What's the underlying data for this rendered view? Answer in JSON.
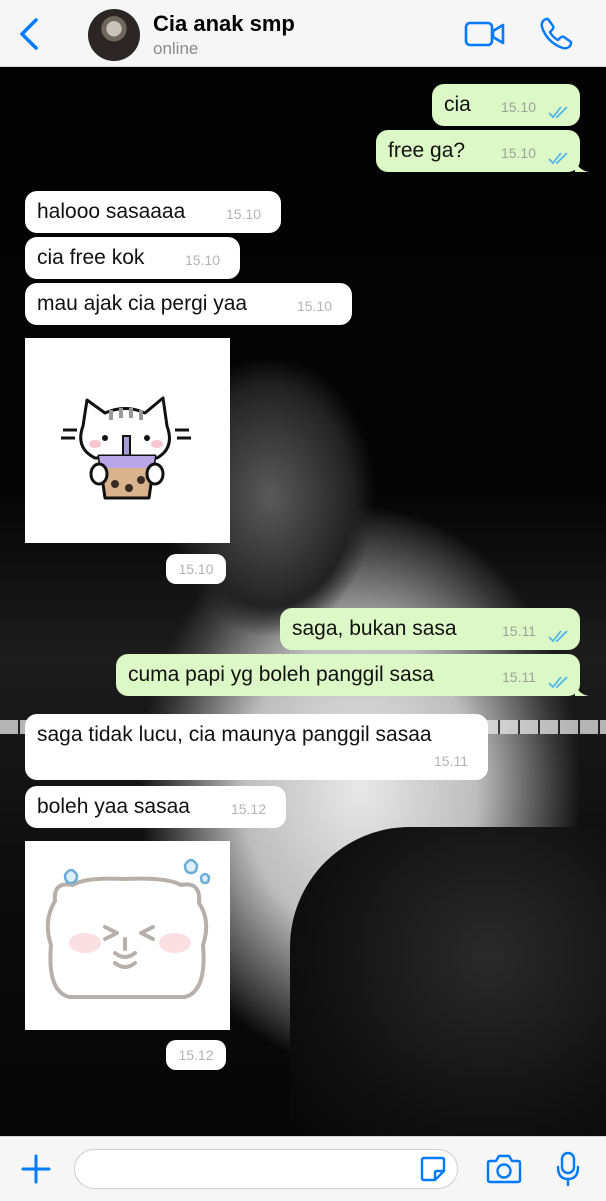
{
  "header": {
    "title": "Cia anak smp",
    "status": "online"
  },
  "messages": [
    {
      "kind": "out",
      "text": "cia",
      "time": "15.10"
    },
    {
      "kind": "out",
      "text": "free ga?",
      "time": "15.10"
    },
    {
      "kind": "in",
      "text": "halooo sasaaaa",
      "time": "15.10"
    },
    {
      "kind": "in",
      "text": "cia free kok",
      "time": "15.10"
    },
    {
      "kind": "in",
      "text": "mau ajak cia pergi yaa",
      "time": "15.10"
    },
    {
      "kind": "sticker",
      "sticker": "cat-drinking-boba-sticker",
      "time": "15.10"
    },
    {
      "kind": "out",
      "text": "saga, bukan sasa",
      "time": "15.11"
    },
    {
      "kind": "out",
      "text": "cuma papi yg boleh panggil sasa",
      "time": "15.11"
    },
    {
      "kind": "in",
      "text": "saga tidak lucu, cia maunya panggil sasaa",
      "time": "15.11"
    },
    {
      "kind": "in",
      "text": "boleh yaa sasaa",
      "time": "15.12"
    },
    {
      "kind": "sticker",
      "sticker": "sweating-bear-sticker",
      "time": "15.12"
    }
  ],
  "composer": {
    "value": "",
    "placeholder": ""
  },
  "colors": {
    "accent": "#007aff",
    "outgoing_bubble": "#dcf8c6",
    "incoming_bubble": "#ffffff",
    "read_ticks": "#4fb6ec"
  },
  "icons": [
    "back-chevron-icon",
    "video-call-icon",
    "phone-icon",
    "plus-icon",
    "sticker-icon",
    "camera-icon",
    "microphone-icon",
    "double-check-icon"
  ]
}
